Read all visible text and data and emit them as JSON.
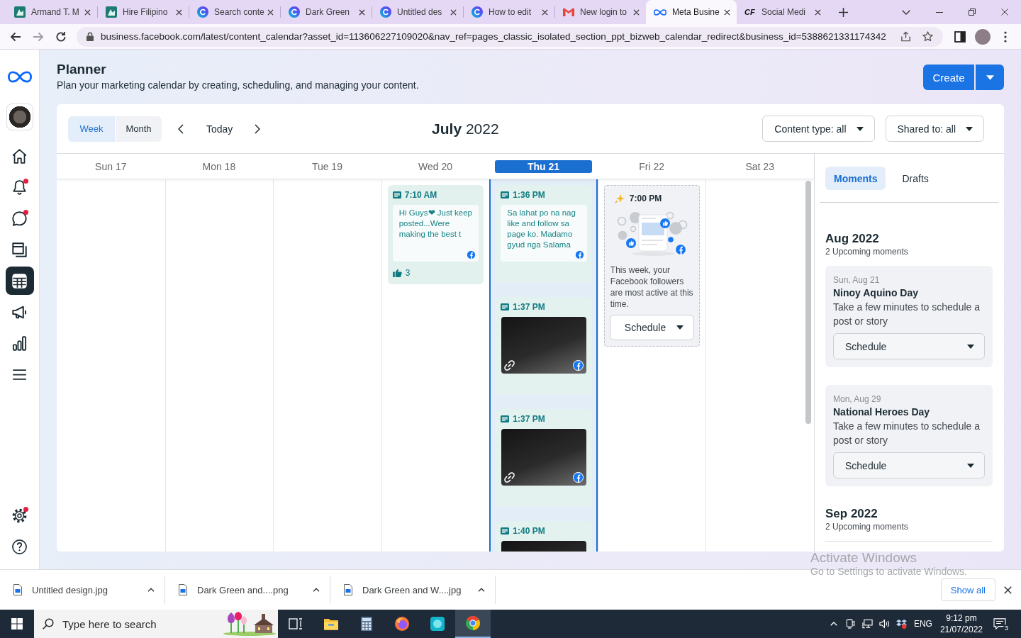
{
  "browser": {
    "tabs": [
      {
        "kind": "site",
        "title": "Armand T. M",
        "selected": false
      },
      {
        "kind": "site",
        "title": "Hire Filipino",
        "selected": false
      },
      {
        "kind": "canva",
        "title": "Search conte",
        "selected": false
      },
      {
        "kind": "canva",
        "title": "Dark Green",
        "selected": false
      },
      {
        "kind": "canva",
        "title": "Untitled des",
        "selected": false
      },
      {
        "kind": "canva",
        "title": "How to edit",
        "selected": false
      },
      {
        "kind": "mail",
        "title": "New login to",
        "selected": false
      },
      {
        "kind": "meta",
        "title": "Meta Busine",
        "selected": true
      },
      {
        "kind": "letters",
        "icon_text": "CF",
        "title": "Social Medi",
        "selected": false
      }
    ],
    "url": "business.facebook.com/latest/content_calendar?asset_id=113606227109020&nav_ref=pages_classic_isolated_section_ppt_bizweb_calendar_redirect&business_id=5388621331174342"
  },
  "sidebar": {
    "items": [
      {
        "kind": "home",
        "selected": false,
        "alert": false
      },
      {
        "kind": "notifications",
        "selected": false,
        "alert": true
      },
      {
        "kind": "inbox",
        "selected": false,
        "alert": true
      },
      {
        "kind": "content",
        "selected": false,
        "alert": false
      },
      {
        "kind": "planner",
        "selected": true,
        "alert": false
      },
      {
        "kind": "ads",
        "selected": false,
        "alert": false
      },
      {
        "kind": "insights",
        "selected": false,
        "alert": false
      },
      {
        "kind": "menu",
        "selected": false,
        "alert": false
      }
    ],
    "footer_items": [
      {
        "kind": "settings",
        "selected": false,
        "alert": true
      },
      {
        "kind": "help",
        "selected": false,
        "alert": false
      }
    ]
  },
  "header": {
    "title": "Planner",
    "subtitle": "Plan your marketing calendar by creating, scheduling, and managing your content.",
    "create_button": "Create"
  },
  "toolbar": {
    "views": [
      {
        "label": "Week",
        "selected": true
      },
      {
        "label": "Month",
        "selected": false
      }
    ],
    "today_button": "Today",
    "title": "**July** 2022",
    "filters": [
      {
        "label": "Content type: all"
      },
      {
        "label": "Shared to: all"
      }
    ]
  },
  "days": [
    {
      "label": "Sun 17",
      "today": false
    },
    {
      "label": "Mon 18",
      "today": false
    },
    {
      "label": "Tue 19",
      "today": false
    },
    {
      "label": "Wed 20",
      "today": false,
      "posts": [
        {
          "kind": "text",
          "time": "7:10 AM",
          "preview": "Hi Guys❤ Just keep posted...Were making the best t",
          "likes": "3"
        }
      ]
    },
    {
      "label": "Thu 21",
      "today": true,
      "posts": [
        {
          "kind": "text",
          "time": "1:36 PM",
          "preview": "Sa lahat po na nag like and follow sa page ko. Madamo gyud nga Salama"
        },
        {
          "kind": "image",
          "time": "1:37 PM"
        },
        {
          "kind": "image",
          "time": "1:37 PM"
        },
        {
          "kind": "image",
          "time": "1:40 PM"
        }
      ]
    },
    {
      "label": "Fri 22",
      "today": false,
      "posts": [
        {
          "kind": "suggestion",
          "time": "7:00 PM",
          "message": "This week, your Facebook followers are most active at this time.",
          "button": "Schedule"
        }
      ]
    },
    {
      "label": "Sat 23",
      "today": false
    }
  ],
  "moments_panel": {
    "tabs": [
      {
        "label": "Moments",
        "selected": true
      },
      {
        "label": "Drafts",
        "selected": false
      }
    ],
    "months": [
      {
        "title": "Aug 2022",
        "count": "2 Upcoming moments",
        "moments": [
          {
            "date": "Sun, Aug 21",
            "name": "Ninoy Aquino Day",
            "text": "Take a few minutes to schedule a post or story",
            "button": "Schedule"
          },
          {
            "date": "Mon, Aug 29",
            "name": "National Heroes Day",
            "text": "Take a few minutes to schedule a post or story",
            "button": "Schedule"
          }
        ]
      },
      {
        "title": "Sep 2022",
        "count": "2 Upcoming moments"
      }
    ]
  },
  "activation_notice": {
    "title": "Activate Windows",
    "text": "Go to Settings to activate Windows."
  },
  "downloads": {
    "files": [
      {
        "name": "Untitled design.jpg"
      },
      {
        "name": "Dark Green and....png"
      },
      {
        "name": "Dark Green and W....jpg"
      }
    ],
    "show_all": "Show all"
  },
  "taskbar": {
    "search": {
      "placeholder": "Type here to search"
    },
    "apps": [
      {
        "kind": "task-view",
        "active": false
      },
      {
        "kind": "file-explorer",
        "active": false
      },
      {
        "kind": "calculator",
        "active": false
      },
      {
        "kind": "firefox",
        "active": false
      },
      {
        "kind": "teal-app",
        "active": false
      },
      {
        "kind": "chrome",
        "active": true
      }
    ],
    "language": "ENG",
    "time": "9:12 pm",
    "date": "21/07/2022",
    "notification_count": "3"
  }
}
